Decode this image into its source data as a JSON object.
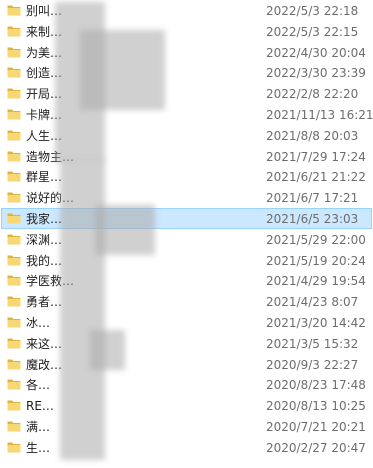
{
  "colors": {
    "folder_fill": "#f8d775",
    "folder_dark": "#e0b43c",
    "selection_bg": "#cce8ff",
    "selection_border": "#99d1ff",
    "date_text": "#6d6d6d"
  },
  "selected_index": 10,
  "rows": [
    {
      "name": "别叫…",
      "date": "2022/5/3 22:18"
    },
    {
      "name": "来制…",
      "date": "2022/5/3 22:15"
    },
    {
      "name": "为美…",
      "date": "2022/4/30 20:04"
    },
    {
      "name": "创造…",
      "date": "2022/3/30 23:39"
    },
    {
      "name": "开局…",
      "date": "2022/2/8 22:20"
    },
    {
      "name": "卡牌…",
      "date": "2021/11/13 16:21"
    },
    {
      "name": "人生…",
      "date": "2021/8/8 20:03"
    },
    {
      "name": "造物主…",
      "date": "2021/7/29 17:24"
    },
    {
      "name": "群星…",
      "date": "2021/6/21 21:22"
    },
    {
      "name": "说好的…",
      "date": "2021/6/7 17:21"
    },
    {
      "name": "我家…",
      "date": "2021/6/5 23:03"
    },
    {
      "name": "深渊…",
      "date": "2021/5/29 22:00"
    },
    {
      "name": "我的…",
      "date": "2021/5/19 20:24"
    },
    {
      "name": "学医救…",
      "date": "2021/4/29 19:54"
    },
    {
      "name": "勇者…",
      "date": "2021/4/23 8:07"
    },
    {
      "name": "冰…",
      "date": "2021/3/20 14:42"
    },
    {
      "name": "来这…",
      "date": "2021/3/5 15:32"
    },
    {
      "name": "魔改…",
      "date": "2020/9/3 22:27"
    },
    {
      "name": "各…",
      "date": "2020/8/23 17:48"
    },
    {
      "name": "RE…",
      "date": "2020/8/13 10:25"
    },
    {
      "name": "满…",
      "date": "2020/7/21 20:21"
    },
    {
      "name": "生…",
      "date": "2020/2/27 20:47"
    }
  ]
}
